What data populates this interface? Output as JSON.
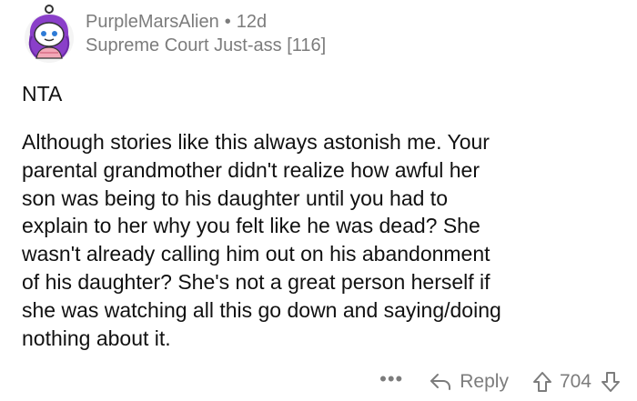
{
  "comment": {
    "username": "PurpleMarsAlien",
    "separator": "•",
    "age": "12d",
    "flair": "Supreme Court Just-ass [116]",
    "verdict": "NTA",
    "body_lines": [
      "Although stories like this always astonish me. Your",
      "parental grandmother didn't realize how awful her",
      "son was being to his daughter until you had to",
      "explain to her why you felt like he was dead?  She",
      "wasn't already calling him out on his abandonment",
      "of his daughter? She's not a great person herself if",
      "she was watching all this go down and saying/doing",
      "nothing about it."
    ]
  },
  "actions": {
    "more": "•••",
    "reply_label": "Reply",
    "vote_count": "704"
  },
  "icons": {
    "avatar": "snoo-avatar-icon",
    "more": "more-options-icon",
    "reply": "reply-arrow-icon",
    "upvote": "upvote-arrow-icon",
    "downvote": "downvote-arrow-icon"
  },
  "colors": {
    "text": "#111111",
    "muted": "#7c7c7c",
    "avatar_hair": "#8a3fc9",
    "avatar_shirt": "#f3a8b8"
  }
}
